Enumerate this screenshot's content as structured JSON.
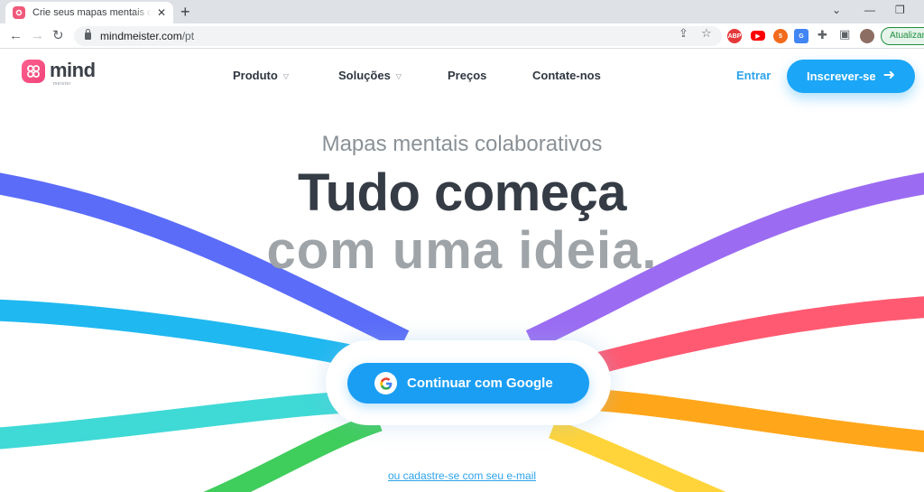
{
  "browser": {
    "tab_title": "Crie seus mapas mentais online - MindMeister",
    "tab_close": "✕",
    "new_tab": "+",
    "url_host": "mindmeister.com",
    "url_path": "/pt",
    "update_label": "Atualizar",
    "extensions": [
      {
        "name": "adblock-plus",
        "label": "ABP",
        "color": "#e5383b"
      },
      {
        "name": "youtube-ext",
        "label": "▶",
        "color": "#ff0000"
      },
      {
        "name": "rss-ext",
        "label": "5",
        "color": "#f26b1d"
      },
      {
        "name": "translate-ext",
        "label": "G",
        "color": "#4285f4"
      }
    ]
  },
  "site": {
    "logo_text": "mind",
    "logo_sub": "meister",
    "nav": [
      {
        "label": "Produto",
        "has_dropdown": true
      },
      {
        "label": "Soluções",
        "has_dropdown": true
      },
      {
        "label": "Preços",
        "has_dropdown": false
      },
      {
        "label": "Contate-nos",
        "has_dropdown": false
      }
    ],
    "login_label": "Entrar",
    "signup_label": "Inscrever-se"
  },
  "hero": {
    "subtitle": "Mapas mentais colaborativos",
    "line1": "Tudo começa",
    "line2": "com uma ideia.",
    "google_label": "Continuar com Google",
    "email_link": "ou cadastre-se com seu e-mail"
  },
  "colors": {
    "accent": "#1ba6f7",
    "ribbon_indigo": "#5b6cf9",
    "ribbon_cyan": "#20b8f0",
    "ribbon_teal": "#3fd9d6",
    "ribbon_green": "#3fcd5c",
    "ribbon_purple": "#9b6cf2",
    "ribbon_red": "#ff5a72",
    "ribbon_orange": "#ffa61a",
    "ribbon_yellow": "#ffd43a"
  }
}
